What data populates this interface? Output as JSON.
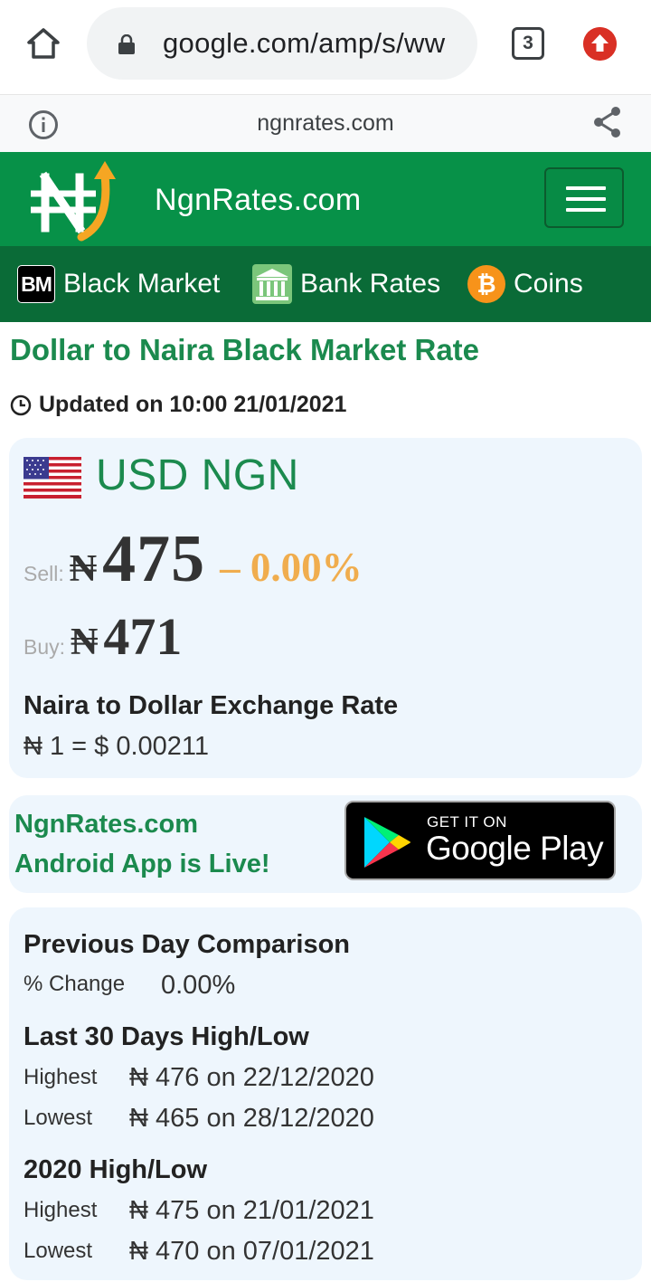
{
  "browser": {
    "url": "google.com/amp/s/ww",
    "tab_count": "3",
    "domain": "ngnrates.com"
  },
  "site": {
    "title": "NgnRates.com",
    "nav": [
      {
        "icon": "BM",
        "label": "Black Market"
      },
      {
        "label": "Bank Rates"
      },
      {
        "icon": "₿",
        "label": "Coins"
      }
    ]
  },
  "page": {
    "title": "Dollar to Naira Black Market Rate",
    "updated": "Updated on 10:00 21/01/2021"
  },
  "rate_card": {
    "pair": "USD NGN",
    "sell_label": "Sell:",
    "currency_symbol": "₦",
    "sell_value": "475",
    "change": "– 0.00%",
    "buy_label": "Buy:",
    "buy_value": "471",
    "exchange_title": "Naira to Dollar Exchange Rate",
    "exchange_value": "₦ 1 = $ 0.00211"
  },
  "app_promo": {
    "line1": "NgnRates.com",
    "line2": "Android App is Live!",
    "badge_small": "GET IT ON",
    "badge_big": "Google Play"
  },
  "stats": {
    "prev_title": "Previous Day Comparison",
    "prev_label": "% Change",
    "prev_value": "0.00%",
    "last30_title": "Last 30 Days High/Low",
    "last30_high_label": "Highest",
    "last30_high_value": "₦ 476 on 22/12/2020",
    "last30_low_label": "Lowest",
    "last30_low_value": "₦ 465 on 28/12/2020",
    "year_title": "2020 High/Low",
    "year_high_label": "Highest",
    "year_high_value": "₦ 475 on 21/01/2021",
    "year_low_label": "Lowest",
    "year_low_value": "₦ 470 on 07/01/2021"
  },
  "colors": {
    "header_green": "#079148",
    "nav_green": "#0a6b37",
    "title_green": "#1b8a4e",
    "change_orange": "#f0ad4e",
    "card_bg": "#eef6fd"
  }
}
